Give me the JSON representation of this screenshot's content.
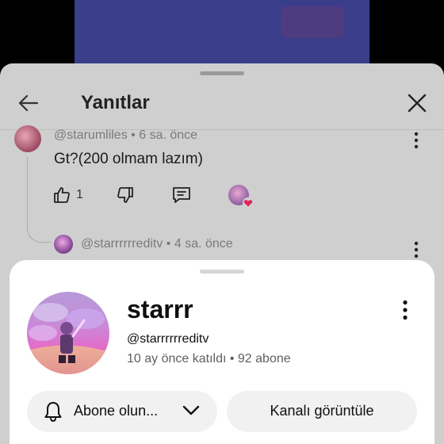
{
  "replies": {
    "title": "Yanıtlar",
    "comment1": {
      "meta": "@starumliles • 6 sa. önce",
      "text": "Gt?(200 olmam lazım)",
      "like_count": "1"
    },
    "comment2": {
      "meta": "@starrrrrreditv • 4 sa. önce"
    }
  },
  "channel": {
    "name": "starrr",
    "handle": "@starrrrrreditv",
    "stats": "10 ay önce katıldı • 92 abone",
    "subscribe_label": "Abone olun...",
    "view_channel_label": "Kanalı görüntüle"
  },
  "icons": {
    "back": "arrow-left-icon",
    "close": "close-icon",
    "more": "more-vert-icon",
    "like": "thumb-up-icon",
    "dislike": "thumb-down-icon",
    "reply": "comment-icon",
    "creator_heart": "heart-icon",
    "bell": "bell-icon",
    "chevron": "chevron-down-icon"
  },
  "colors": {
    "sheet_background": "#ffffff",
    "dimmed_background": "#cfcfcf",
    "pill_background": "#f1f1f1",
    "heart": "#e0245e"
  }
}
